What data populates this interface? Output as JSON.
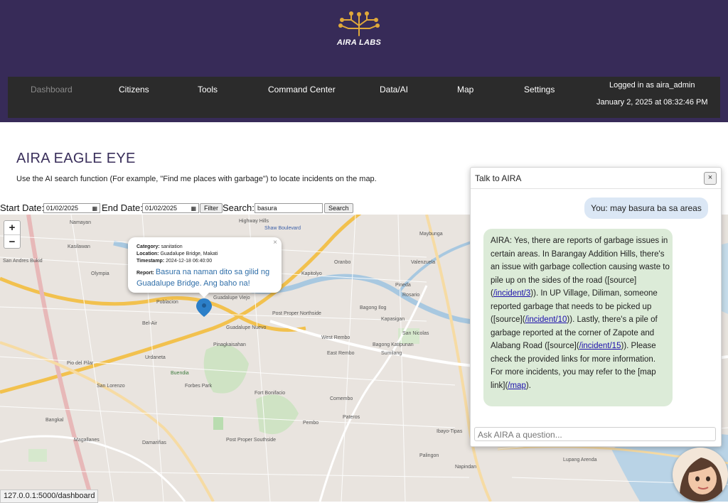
{
  "brand": {
    "name": "AIRA LABS",
    "colors": {
      "header": "#372b58",
      "navbar": "#2b2b2b",
      "logo_gold": "#e0a93a"
    }
  },
  "nav": {
    "items": [
      "Dashboard",
      "Citizens",
      "Tools",
      "Command Center",
      "Data/AI",
      "Map",
      "Settings"
    ],
    "active": "Dashboard",
    "login_text": "Logged in as aira_admin",
    "datetime": "January 2, 2025 at 08:32:46 PM"
  },
  "page": {
    "title": "AIRA EAGLE EYE",
    "description": "Use the AI search function (For example, \"Find me places with garbage\") to locate incidents on the map."
  },
  "filters": {
    "start_label": "Start Date:",
    "start_value": "01/02/2025",
    "end_label": "End Date:",
    "end_value": "01/02/2025",
    "filter_button": "Filter",
    "search_label": "Search:",
    "search_value": "basura",
    "search_button": "Search"
  },
  "map": {
    "zoom_in": "+",
    "zoom_out": "−",
    "labels": [
      "Namayan",
      "Highway Hills",
      "Shaw Boulevard",
      "Maybunga",
      "Kasilawan",
      "San Andres Bukid",
      "Olympia",
      "Valenzuela",
      "Poblacion",
      "Guadalupe Viejo",
      "Guadalupe Nuevo",
      "Pinagkaisahan",
      "Urdaneta",
      "Post Proper Northside",
      "West Rembo",
      "East Rembo",
      "Bagong Ilog",
      "Kapasigan",
      "San Nicolas",
      "Sumilang",
      "Bagong Katipunan",
      "Fort Bonifacio",
      "Forbes Park",
      "San Lorenzo",
      "Pembo",
      "Comembo",
      "Pateros",
      "Post Proper Southside",
      "Magallanes",
      "Bangkal",
      "Damariñas",
      "Ibayo-Tipas",
      "Palingon",
      "Napindan",
      "Lupang Arenda",
      "Pio del Pilar",
      "Bel-Air",
      "Kapitolyo",
      "Oranbo",
      "Rosario",
      "Pineda",
      "Buendia"
    ],
    "popup": {
      "category_label": "Category:",
      "category": "sanitation",
      "location_label": "Location:",
      "location": "Guadalupe Bridge, Makati",
      "timestamp_label": "Timestamp:",
      "timestamp": "2024-12-18 06:40:00",
      "report_label": "Report:",
      "report": "Basura na naman dito sa gilid ng Guadalupe Bridge. Ang baho na!",
      "close": "×"
    }
  },
  "status_bar": "127.0.0.1:5000/dashboard",
  "chat": {
    "title": "Talk to AIRA",
    "close": "×",
    "user_message": "You: may basura ba sa areas",
    "ai_message": {
      "p1": "AIRA: Yes, there are reports of garbage issues in certain areas. In Barangay Addition Hills, there's an issue with garbage collection causing waste to pile up on the sides of the road ([source](",
      "link1": "/incident/3",
      "p2": ")). In UP Village, Diliman, someone reported garbage that needs to be picked up ([source](",
      "link2": "/incident/10",
      "p3": ")). Lastly, there's a pile of garbage reported at the corner of Zapote and Alabang Road ([source](",
      "link3": "/incident/15",
      "p4": ")). Please check the provided links for more information. For more incidents, you may refer to the [map link](",
      "link4": "/map",
      "p5": ")."
    },
    "input_placeholder": "Ask AIRA a question..."
  }
}
